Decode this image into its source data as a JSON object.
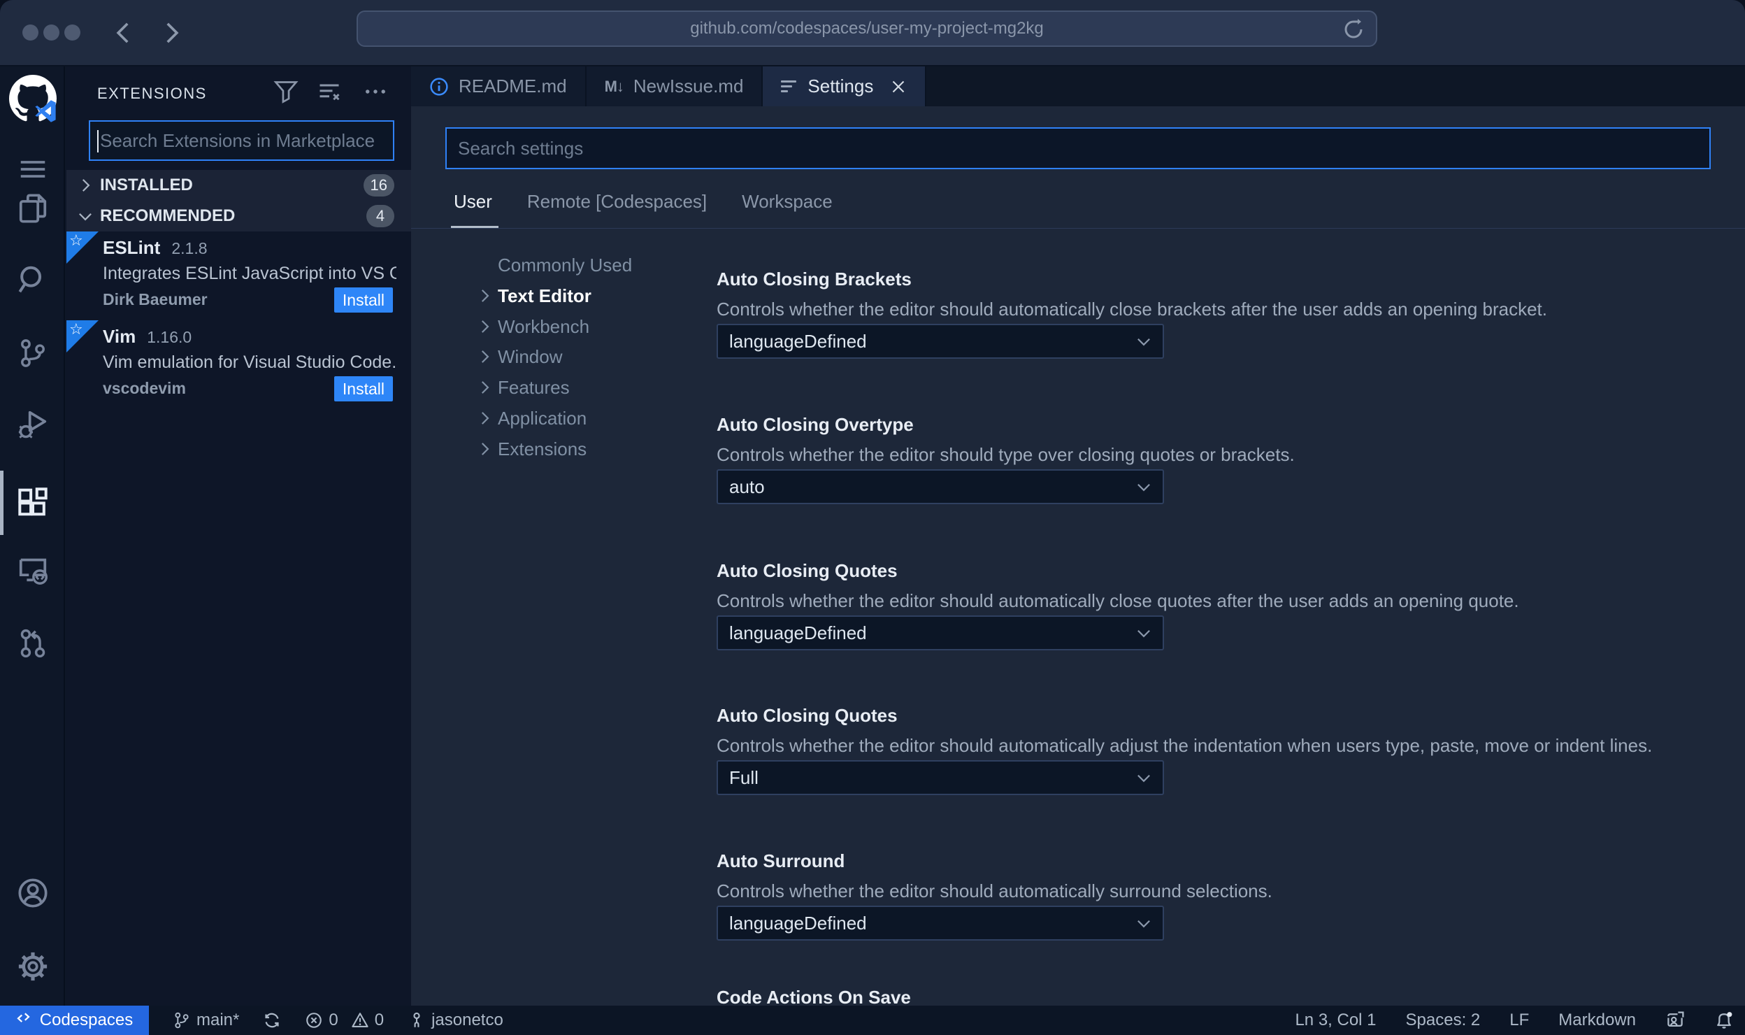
{
  "browser": {
    "url": "github.com/codespaces/user-my-project-mg2kg"
  },
  "activity_bar": {
    "icons": [
      "github-logo",
      "menu",
      "explorer",
      "search",
      "source-control",
      "run-and-debug",
      "extensions",
      "remote-explorer",
      "pull-requests",
      "account",
      "settings-gear"
    ],
    "active": "extensions"
  },
  "sidebar": {
    "title": "EXTENSIONS",
    "search": {
      "placeholder": "Search Extensions in Marketplace",
      "value": ""
    },
    "sections": [
      {
        "label": "INSTALLED",
        "count": "16",
        "state": "collapsed"
      },
      {
        "label": "RECOMMENDED",
        "count": "4",
        "state": "expanded"
      }
    ],
    "extensions": [
      {
        "name": "ESLint",
        "version": "2.1.8",
        "description": "Integrates ESLint JavaScript into VS C...",
        "author": "Dirk Baeumer",
        "action": "Install"
      },
      {
        "name": "Vim",
        "version": "1.16.0",
        "description": "Vim emulation for Visual Studio Code...",
        "author": "vscodevim",
        "action": "Install"
      }
    ]
  },
  "editor": {
    "tabs": [
      {
        "label": "README.md",
        "icon": "info-icon",
        "active": false
      },
      {
        "label": "NewIssue.md",
        "icon": "markdown-icon",
        "active": false
      },
      {
        "label": "Settings",
        "icon": "settings-doc-icon",
        "active": true
      }
    ],
    "markdown_glyph": "M↓"
  },
  "settings": {
    "search": {
      "placeholder": "Search settings",
      "value": ""
    },
    "scopes": [
      {
        "label": "User",
        "active": true
      },
      {
        "label": "Remote [Codespaces]",
        "active": false
      },
      {
        "label": "Workspace",
        "active": false
      }
    ],
    "toc": [
      {
        "label": "Commonly Used",
        "chevron": false,
        "active": false
      },
      {
        "label": "Text Editor",
        "chevron": true,
        "active": true
      },
      {
        "label": "Workbench",
        "chevron": true,
        "active": false
      },
      {
        "label": "Window",
        "chevron": true,
        "active": false
      },
      {
        "label": "Features",
        "chevron": true,
        "active": false
      },
      {
        "label": "Application",
        "chevron": true,
        "active": false
      },
      {
        "label": "Extensions",
        "chevron": true,
        "active": false
      }
    ],
    "items": [
      {
        "title": "Auto Closing Brackets",
        "description": "Controls whether the editor should automatically close brackets after the user adds an opening bracket.",
        "value": "languageDefined"
      },
      {
        "title": "Auto Closing Overtype",
        "description": "Controls whether the editor should type over closing quotes or brackets.",
        "value": "auto"
      },
      {
        "title": "Auto Closing Quotes",
        "description": "Controls whether the editor should automatically close quotes after the user adds an opening quote.",
        "value": "languageDefined"
      },
      {
        "title": "Auto Closing Quotes",
        "description": "Controls whether the editor should automatically adjust the indentation when users type, paste, move or indent lines.",
        "value": "Full"
      },
      {
        "title": "Auto Surround",
        "description": "Controls whether the editor should automatically surround selections.",
        "value": "languageDefined"
      },
      {
        "title": "Code Actions On Save",
        "description": "",
        "value": ""
      }
    ]
  },
  "status_bar": {
    "codespaces": "Codespaces",
    "branch": "main*",
    "errors": "0",
    "warnings": "0",
    "user": "jasonetco",
    "line_col": "Ln 3, Col 1",
    "indentation": "Spaces: 2",
    "eol": "LF",
    "language": "Markdown"
  },
  "colors": {
    "accent": "#2f81f7",
    "install": "#2e86f8",
    "codespaces": "#2467e0",
    "ribbon": "#1f7ce8"
  }
}
